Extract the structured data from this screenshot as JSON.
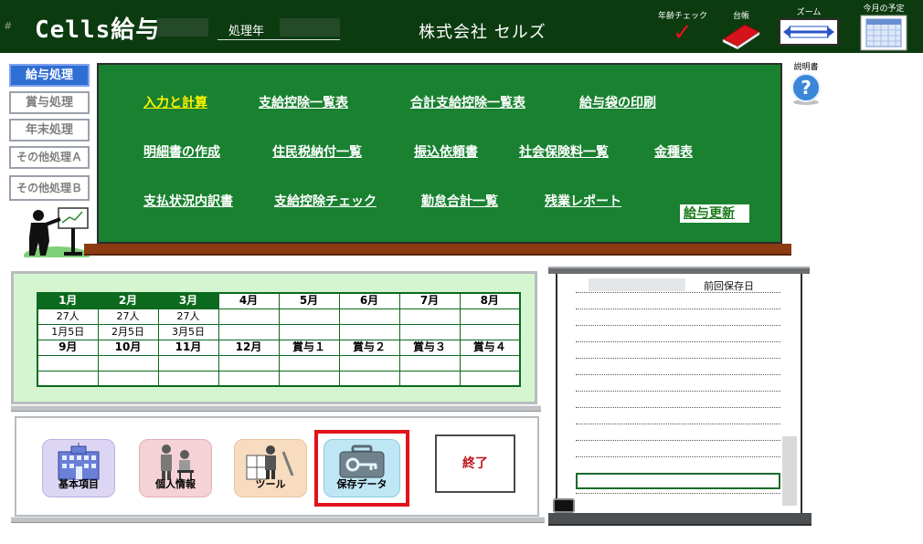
{
  "header": {
    "hash": "#",
    "app_title": "Cells給与",
    "year_label": "処理年",
    "company": "株式会社 セルズ",
    "tools": [
      {
        "label": "年齢チェック",
        "icon": "red-checkmark-icon"
      },
      {
        "label": "台帳",
        "icon": "red-ledger-book-icon"
      },
      {
        "label": "ズーム",
        "icon": "zoom-arrows-icon"
      },
      {
        "label": "今月の予定",
        "icon": "calendar-icon"
      }
    ]
  },
  "sidebar": {
    "items": [
      {
        "label": "給与処理",
        "active": true
      },
      {
        "label": "賞与処理",
        "active": false
      },
      {
        "label": "年末処理",
        "active": false
      },
      {
        "label": "その他処理Ａ",
        "active": false
      },
      {
        "label": "その他処理Ｂ",
        "active": false
      }
    ]
  },
  "board": {
    "row1": [
      "入力と計算",
      "支給控除一覧表",
      "合計支給控除一覧表",
      "給与袋の印刷"
    ],
    "row2": [
      "明細書の作成",
      "住民税納付一覧",
      "振込依頼書",
      "社会保険料一覧",
      "金種表"
    ],
    "row3": [
      "支払状況内訳書",
      "支給控除チェック",
      "勤怠合計一覧",
      "残業レポート"
    ],
    "update_button": "給与更新"
  },
  "help": {
    "label": "説明書",
    "icon": "help-question-icon"
  },
  "calendar": {
    "top_headers": [
      "1月",
      "2月",
      "3月",
      "4月",
      "5月",
      "6月",
      "7月",
      "8月"
    ],
    "top_counts": [
      "27人",
      "27人",
      "27人",
      "",
      "",
      "",
      "",
      ""
    ],
    "top_dates": [
      "1月5日",
      "2月5日",
      "3月5日",
      "",
      "",
      "",
      "",
      ""
    ],
    "bottom_headers": [
      "9月",
      "10月",
      "11月",
      "12月",
      "賞与１",
      "賞与２",
      "賞与３",
      "賞与４"
    ]
  },
  "buttons": {
    "basic": "基本項目",
    "personal": "個人情報",
    "tools": "ツール",
    "saved": "保存データ",
    "exit": "終了"
  },
  "right_panel": {
    "header": "前回保存日"
  },
  "colors": {
    "header_bg": "#0c3b10",
    "board_green": "#198130",
    "active_tab": "#2f6ed3",
    "highlight_link": "#fff200",
    "save_frame": "#e2121b"
  }
}
